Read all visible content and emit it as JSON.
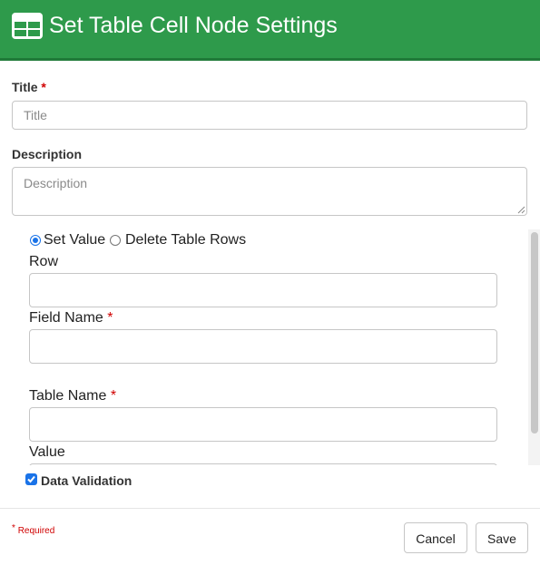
{
  "header": {
    "title": "Set Table Cell Node Settings",
    "icon": "table-icon",
    "bg_color": "#2e9a4b"
  },
  "form": {
    "title_label": "Title",
    "title_required_mark": "*",
    "title_placeholder": "Title",
    "title_value": "",
    "description_label": "Description",
    "description_placeholder": "Description",
    "description_value": ""
  },
  "panel": {
    "mode_options": [
      {
        "label": "Set Value",
        "selected": true
      },
      {
        "label": "Delete Table Rows",
        "selected": false
      }
    ],
    "row_label": "Row",
    "row_value": "",
    "field_name_label": "Field Name",
    "field_name_required_mark": "*",
    "field_name_value": "",
    "table_name_label": "Table Name",
    "table_name_required_mark": "*",
    "table_name_value": "",
    "value_label": "Value",
    "value_value": ""
  },
  "data_validation": {
    "label": "Data Validation",
    "checked": true
  },
  "footer": {
    "required_mark": "*",
    "required_note": "Required",
    "cancel_label": "Cancel",
    "save_label": "Save"
  }
}
